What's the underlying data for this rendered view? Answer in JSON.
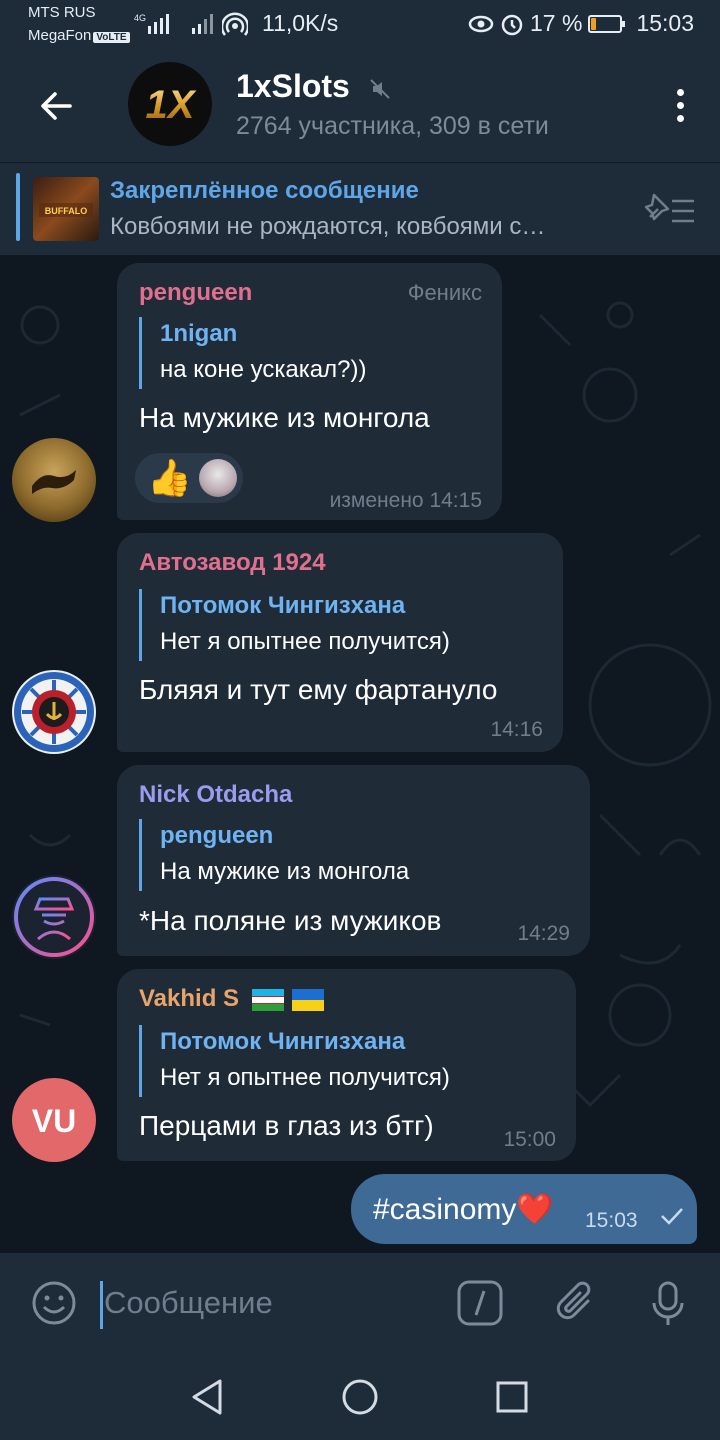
{
  "status_bar": {
    "operator1": "MTS RUS",
    "operator2": "MegaFon",
    "volte": "VoLTE",
    "net": "4G",
    "speed": "11,0K/s",
    "battery": "17 %",
    "battery_level": 0.17,
    "time": "15:03"
  },
  "header": {
    "title": "1xSlots",
    "subtitle": "2764 участника, 309 в сети",
    "avatar_text": "1X"
  },
  "pinned": {
    "title": "Закреплённое сообщение",
    "text": "Ковбоями не рождаются, ковбоями с…",
    "thumb_text": "BUFFALO"
  },
  "messages": [
    {
      "sender": "pengueen",
      "rank": "Феникс",
      "reply_name": "1nigan",
      "reply_text": "на коне ускакал?))",
      "text": "На мужике из монгола",
      "time": "изменено 14:15",
      "reaction": "👍"
    },
    {
      "sender": "Автозавод 1924",
      "reply_name": "Потомок Чингизхана",
      "reply_text": "Нет я опытнее получится)",
      "text": "Бляяя и тут ему фартануло",
      "time": "14:16"
    },
    {
      "sender": "Nick Otdacha",
      "reply_name": "pengueen",
      "reply_text": "На мужике из монгола",
      "text": "*На поляне из мужиков",
      "time": "14:29"
    },
    {
      "sender": "Vakhid S",
      "reply_name": "Потомок Чингизхана",
      "reply_text": "Нет я опытнее получится)",
      "text": "Перцами в глаз из бтг)",
      "time": "15:00",
      "avatar_text": "VU"
    }
  ],
  "outgoing": {
    "text": "#casinomy❤️",
    "time": "15:03"
  },
  "composer": {
    "placeholder": "Сообщение"
  },
  "colors": {
    "accent": "#5fa6e8",
    "sender1": "#e1708f",
    "sender2": "#e1708f",
    "sender3": "#9d9bf0",
    "sender4": "#e8a46a",
    "out_bubble": "#3e6a95"
  }
}
